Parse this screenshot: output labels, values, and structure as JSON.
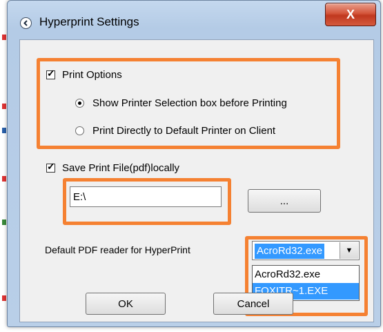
{
  "window": {
    "title": "Hyperprint Settings",
    "close_label": "X"
  },
  "print_options": {
    "label": "Print Options",
    "checked": true,
    "radios": [
      {
        "label": "Show Printer Selection box before Printing",
        "selected": true
      },
      {
        "label": "Print Directly to Default Printer on Client",
        "selected": false
      }
    ]
  },
  "save_print": {
    "label": "Save Print File(pdf)locally",
    "checked": true,
    "path_value": "E:\\",
    "browse_label": "..."
  },
  "pdf_reader": {
    "label": "Default PDF reader for HyperPrint",
    "selected_value": "AcroRd32.exe",
    "options": [
      "AcroRd32.exe",
      "FOXITR~1.EXE"
    ],
    "highlighted_option": "FOXITR~1.EXE"
  },
  "buttons": {
    "ok_label": "OK",
    "cancel_label": "Cancel"
  },
  "colors": {
    "highlight_box": "#f58132",
    "selection": "#3399ff",
    "close_button": "#c8452b"
  },
  "icons": {
    "title_icon": "circle-arrow-icon",
    "combo_arrow": "chevron-down-icon"
  }
}
